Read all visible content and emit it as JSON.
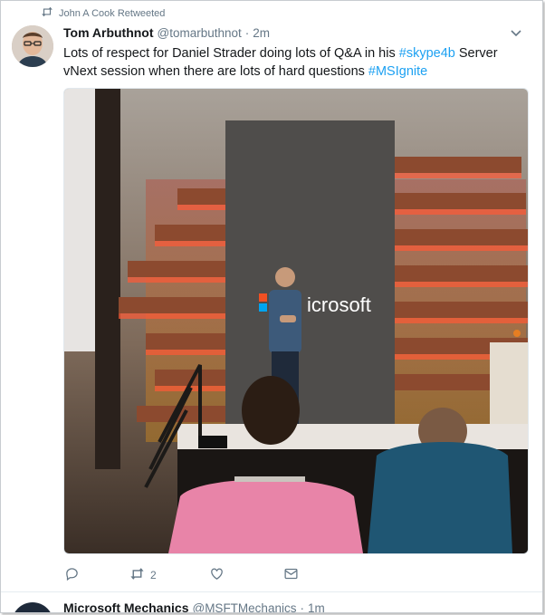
{
  "retweet": {
    "label": "John A Cook Retweeted"
  },
  "tweet": {
    "name": "Tom Arbuthnot",
    "handle": "@tomarbuthnot",
    "separator": "·",
    "time": "2m",
    "text_parts": {
      "p1": "Lots of respect for Daniel Strader doing lots of Q&A in his ",
      "tag1": "#skype4b",
      "p2": " Server vNext session when there are lots of hard questions ",
      "tag2": "#MSIgnite"
    },
    "photo_sign": "icrosoft"
  },
  "actions": {
    "reply_count": "",
    "retweet_count": "2",
    "like_count": ""
  },
  "next_tweet": {
    "name": "Microsoft Mechanics",
    "handle": "@MSFTMechanics",
    "separator": "·",
    "time": "1m"
  },
  "colors": {
    "link": "#1da1f2",
    "secondary": "#657786",
    "text": "#14171a"
  }
}
